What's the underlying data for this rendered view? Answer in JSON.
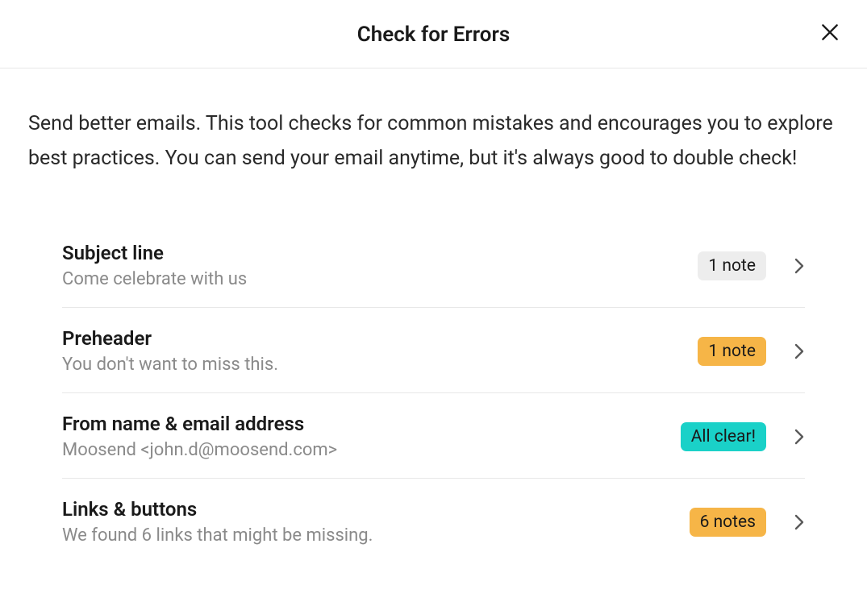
{
  "header": {
    "title": "Check for Errors"
  },
  "intro": "Send better emails. This tool checks for common mistakes and encourages you to explore best practices. You can send your email anytime, but it's always good to double check!",
  "items": [
    {
      "title": "Subject line",
      "subtitle": "Come celebrate with us",
      "badge": "1 note",
      "badgeType": "neutral"
    },
    {
      "title": "Preheader",
      "subtitle": "You don't want to miss this.",
      "badge": "1 note",
      "badgeType": "warning"
    },
    {
      "title": "From name & email address",
      "subtitle": "Moosend <john.d@moosend.com>",
      "badge": "All clear!",
      "badgeType": "success"
    },
    {
      "title": "Links & buttons",
      "subtitle": "We found 6 links that might be missing.",
      "badge": "6 notes",
      "badgeType": "warning"
    }
  ]
}
